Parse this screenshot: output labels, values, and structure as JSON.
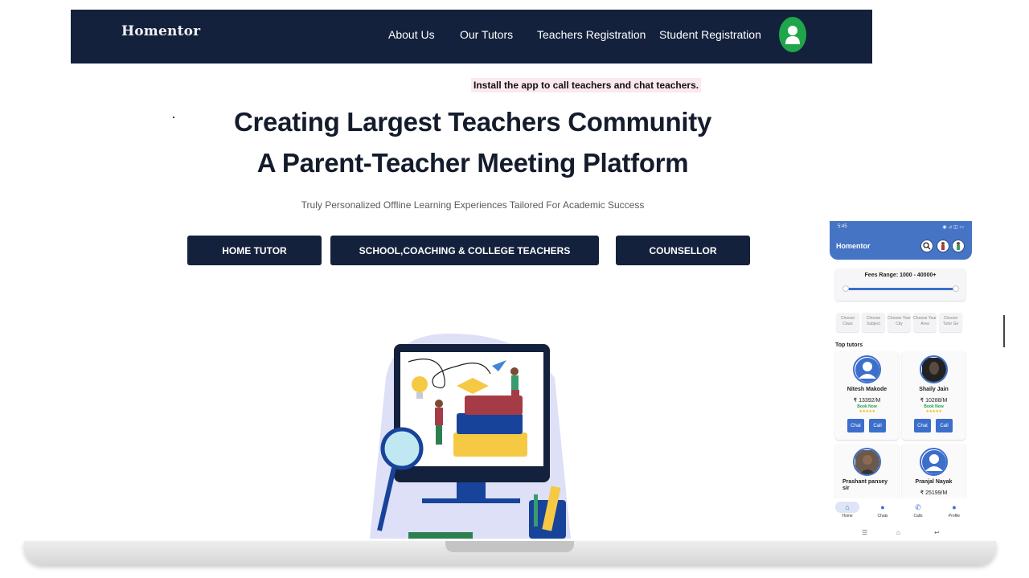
{
  "nav": {
    "brand": "Homentor",
    "links": [
      "About Us",
      "Our Tutors",
      "Teachers Registration",
      "Student Registration"
    ]
  },
  "install_text": "Install the app to call teachers and chat teachers.",
  "hero": {
    "line1": "Creating Largest Teachers Community",
    "line2": "A Parent-Teacher Meeting Platform",
    "subtitle": "Truly Personalized Offline Learning Experiences Tailored For Academic Success"
  },
  "categories": [
    "HOME TUTOR",
    "SCHOOL,COACHING & COLLEGE TEACHERS",
    "COUNSELLOR"
  ],
  "phone": {
    "status_time": "5:45",
    "status_icons": "◉ ⊿ ◫ ▭",
    "title": "Homentor",
    "fees_range": "Fees Range: 1000 - 40000+",
    "fees_slider": {
      "min": 1000,
      "max": 40000
    },
    "filters": [
      "Choose Class",
      "Choose Subject",
      "Choose Your City",
      "Choose Your Area",
      "Choose Tutor Ge"
    ],
    "top_tutors_label": "Top tutors",
    "tutors": [
      {
        "name": "Nitesh Makode",
        "price": "₹ 13392/M",
        "book": "Book Now",
        "stars": "★★★★★",
        "chat": "Chat",
        "call": "Call"
      },
      {
        "name": "Shaily Jain",
        "price": "₹ 10288/M",
        "book": "Book Now",
        "stars": "★★★★★",
        "chat": "Chat",
        "call": "Call"
      },
      {
        "name": "Prashant pansey sir",
        "price": "",
        "book": "",
        "stars": "",
        "chat": "",
        "call": ""
      },
      {
        "name": "Pranjal Nayak",
        "price": "₹ 25199/M",
        "book": "",
        "stars": "",
        "chat": "",
        "call": ""
      }
    ],
    "bottom_nav": [
      "Home",
      "Chats",
      "Calls",
      "Profile"
    ]
  },
  "colors": {
    "navy": "#14213d",
    "accent_green": "#1fa64a",
    "phone_blue": "#4674c4"
  }
}
